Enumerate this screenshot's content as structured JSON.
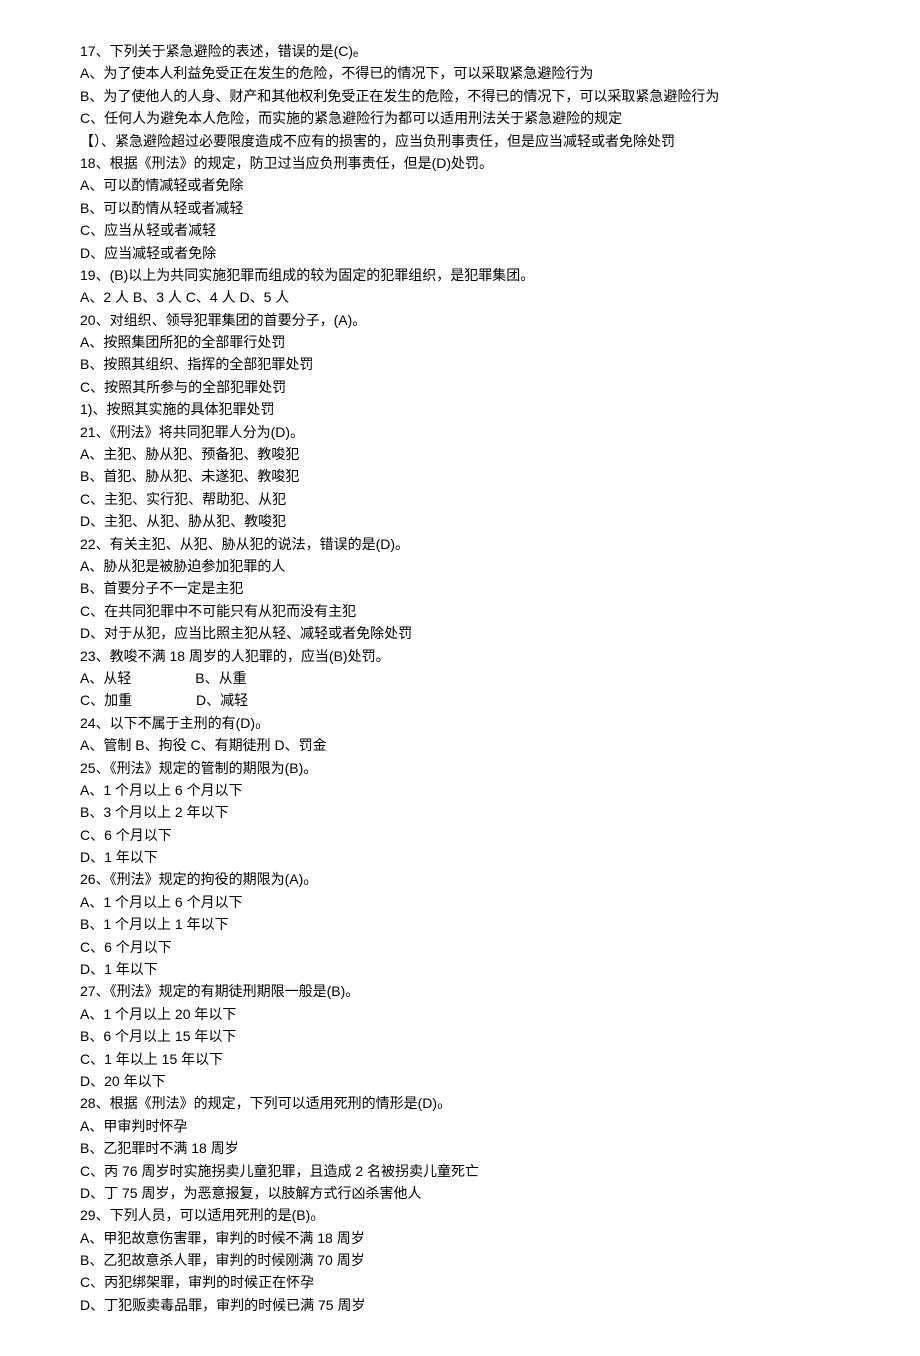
{
  "lines": [
    "17、下列关于紧急避险的表述，错误的是(C)ₑ",
    "A、为了使本人利益免受正在发生的危险，不得已的情况下，可以采取紧急避险行为",
    "B、为了使他人的人身、财产和其他权利免受正在发生的危险，不得已的情况下，可以采取紧急避险行为",
    "C、任何人为避免本人危险，而实施的紧急避险行为都可以适用刑法关于紧急避险的规定",
    "【）、紧急避险超过必要限度造成不应有的损害的，应当负刑事责任，但是应当减轻或者免除处罚",
    "18、根据《刑法》的规定，防卫过当应负刑事责任，但是(D)处罚。",
    "A、可以酌情减轻或者免除",
    "B、可以酌情从轻或者减轻",
    "C、应当从轻或者减轻",
    "D、应当减轻或者免除",
    "19、(B)以上为共同实施犯罪而组成的较为固定的犯罪组织，是犯罪集团。",
    "A、2 人 B、3 人 C、4 人 D、5 人",
    "20、对组织、领导犯罪集团的首要分子，(A)。",
    "A、按照集团所犯的全部罪行处罚",
    "B、按照其组织、指挥的全部犯罪处罚",
    "C、按照其所参与的全部犯罪处罚",
    "1)、按照其实施的具体犯罪处罚",
    "21、《刑法》将共同犯罪人分为(D)。",
    "A、主犯、胁从犯、预备犯、教唆犯",
    "B、首犯、胁从犯、未遂犯、教唆犯",
    "C、主犯、实行犯、帮助犯、从犯",
    "D、主犯、从犯、胁从犯、教唆犯",
    "22、有关主犯、从犯、胁从犯的说法，错误的是(D)。",
    "A、胁从犯是被胁迫参加犯罪的人",
    "B、首要分子不一定是主犯",
    "C、在共同犯罪中不可能只有从犯而没有主犯",
    "D、对于从犯，应当比照主犯从轻、减轻或者免除处罚",
    "23、教唆不满 18 周岁的人犯罪的，应当(B)处罚。"
  ],
  "q23_opts_row1": {
    "a": "A、从轻",
    "b": "B、从重"
  },
  "q23_opts_row2": {
    "c": "C、加重",
    "d": "D、减轻"
  },
  "lines2": [
    "24、以下不属于主刑的有(D)₀",
    "A、管制 B、拘役 C、有期徒刑 D、罚金",
    "25、《刑法》规定的管制的期限为(B)。",
    "A、1 个月以上 6 个月以下",
    "B、3 个月以上 2 年以下",
    "C、6 个月以下",
    "D、1 年以下",
    "26、《刑法》规定的拘役的期限为(A)₀",
    "A、1 个月以上 6 个月以下",
    "B、1 个月以上 1 年以下",
    "C、6 个月以下",
    "D、1 年以下",
    "27、《刑法》规定的有期徒刑期限一般是(B)。",
    "A、1 个月以上 20 年以下",
    "B、6 个月以上 15 年以下",
    "C、1 年以上 15 年以下",
    "D、20 年以下",
    "28、根据《刑法》的规定，下列可以适用死刑的情形是(D)₀",
    "A、甲审判时怀孕",
    "B、乙犯罪时不满 18 周岁",
    "C、丙 76 周岁时实施拐卖儿童犯罪，且造成 2 名被拐卖儿童死亡",
    "D、丁 75 周岁，为恶意报复，以肢解方式行凶杀害他人",
    "29、下列人员，可以适用死刑的是(B)₀",
    "A、甲犯故意伤害罪，审判的时候不满 18 周岁",
    "B、乙犯故意杀人罪，审判的时候刚满 70 周岁",
    "C、丙犯绑架罪，审判的时候正在怀孕",
    "D、丁犯贩卖毒品罪，审判的时候已满 75 周岁"
  ]
}
